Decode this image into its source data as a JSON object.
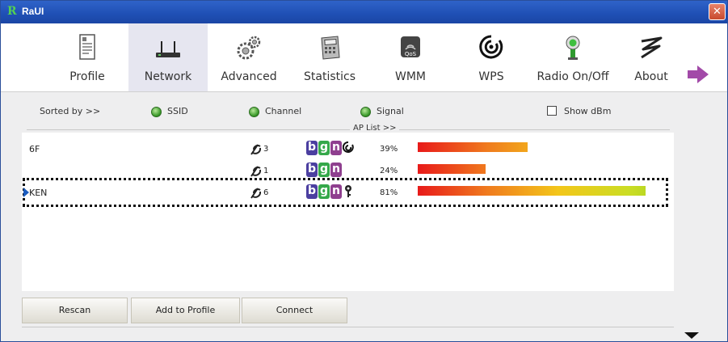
{
  "window": {
    "logo": "R",
    "title": "RaUI",
    "close": "✕"
  },
  "toolbar": {
    "items": [
      {
        "label": "Profile",
        "icon": "profile-icon"
      },
      {
        "label": "Network",
        "icon": "network-icon",
        "selected": true
      },
      {
        "label": "Advanced",
        "icon": "advanced-icon"
      },
      {
        "label": "Statistics",
        "icon": "statistics-icon"
      },
      {
        "label": "WMM",
        "icon": "wmm-icon"
      },
      {
        "label": "WPS",
        "icon": "wps-icon"
      },
      {
        "label": "Radio On/Off",
        "icon": "radio-icon"
      },
      {
        "label": "About",
        "icon": "about-icon"
      }
    ],
    "more": "arrow-right-icon"
  },
  "sortbar": {
    "sorted_by": "Sorted by >>",
    "ssid": "SSID",
    "channel": "Channel",
    "signal": "Signal",
    "show_dbm": "Show dBm",
    "ap_list": "AP List >>"
  },
  "ap_list": [
    {
      "ssid": "6F",
      "channel": "3",
      "security": "wps",
      "signal": "39%",
      "signal_value": 0.39
    },
    {
      "ssid": "",
      "channel": "1",
      "security": "none",
      "signal": "24%",
      "signal_value": 0.24
    },
    {
      "ssid": "KEN",
      "channel": "6",
      "security": "key",
      "signal": "81%",
      "signal_value": 0.81,
      "selected": true
    }
  ],
  "buttons": {
    "rescan": "Rescan",
    "add_to_profile": "Add to Profile",
    "connect": "Connect"
  },
  "colors": {
    "badge_b": "#4b3fa0",
    "badge_g": "#35a84a",
    "badge_n": "#8f3f8f",
    "selected_pointer": "#1a5bbf"
  }
}
